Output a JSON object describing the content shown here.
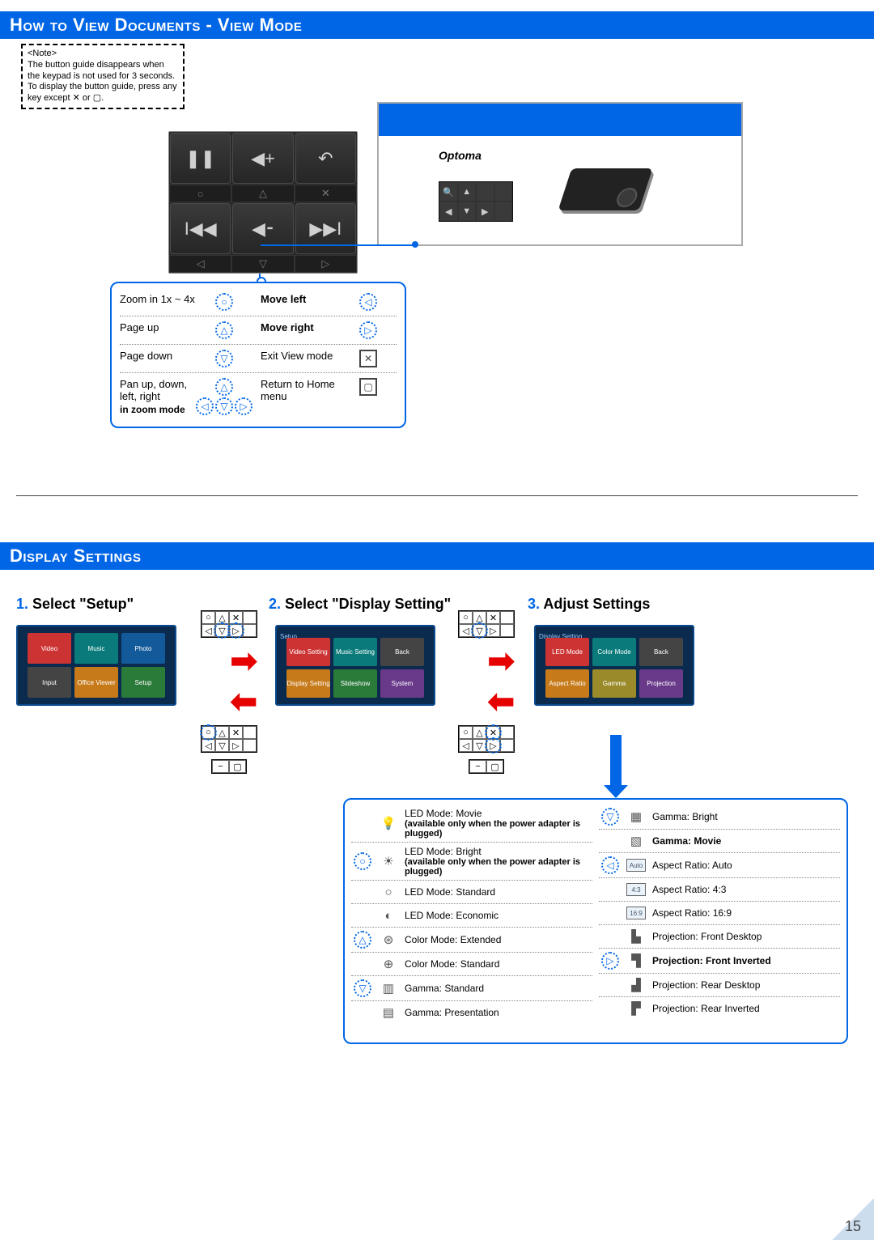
{
  "header1": "How to View Documents - View Mode",
  "note": {
    "title": "<Note>",
    "line1": "The button guide disappears when the keypad is not used for 3 seconds.",
    "line2": "To display the button guide, press any key except ✕ or ▢."
  },
  "media_panel": {
    "btn_pause": "❚❚",
    "btn_volup": "◀+",
    "btn_back": "↶",
    "sub_o": "○",
    "sub_tri": "△",
    "sub_x": "✕",
    "btn_prev": "I◀◀",
    "btn_voldn": "◀⁃",
    "btn_next": "▶▶I",
    "sub_l": "◁",
    "sub_d": "▽",
    "sub_r": "▷"
  },
  "wire_brand": "Optoma",
  "legend": {
    "r1a": "Zoom in 1x ~ 4x",
    "r1b": "Move left",
    "r2a": "Page up",
    "r2b": "Move right",
    "r3a": "Page down",
    "r3b": "Exit View mode",
    "r4a": "Pan up, down, left, right",
    "r4a_note": "in zoom mode",
    "r4b": "Return to Home menu"
  },
  "header2": "Display Settings",
  "step1": {
    "num": "1.",
    "label": "Select \"Setup\""
  },
  "step2": {
    "num": "2.",
    "label": "Select \"Display Setting\""
  },
  "step3": {
    "num": "3.",
    "label": "Adjust Settings"
  },
  "menu1": [
    "Video",
    "Music",
    "Photo",
    "Input",
    "Office Viewer",
    "Setup"
  ],
  "menu2": [
    "Video Setting",
    "Music Setting",
    "Back",
    "Display Setting",
    "Slideshow",
    "System"
  ],
  "menu3": [
    "LED Mode",
    "Color Mode",
    "Back",
    "Aspect Ratio",
    "Gamma",
    "Projection"
  ],
  "setup_label": "Setup",
  "display_setting_label": "Display Setting",
  "info_left": {
    "i1": "LED Mode: Movie",
    "i1_sub": "(available only when the power adapter is plugged)",
    "i2": "LED Mode: Bright",
    "i2_sub": "(available only when the power adapter is plugged)",
    "i3": "LED Mode: Standard",
    "i4": "LED Mode: Economic",
    "i5": "Color Mode: Extended",
    "i6": "Color Mode: Standard",
    "i7": "Gamma: Standard",
    "i8": "Gamma: Presentation"
  },
  "info_right": {
    "i1": "Gamma: Bright",
    "i2": "Gamma: Movie",
    "i3": "Aspect Ratio: Auto",
    "i4": "Aspect Ratio: 4:3",
    "i5": "Aspect Ratio: 16:9",
    "i6": "Projection: Front Desktop",
    "i7": "Projection: Front Inverted",
    "i8": "Projection: Rear Desktop",
    "i9": "Projection: Rear Inverted"
  },
  "page_number": "15"
}
